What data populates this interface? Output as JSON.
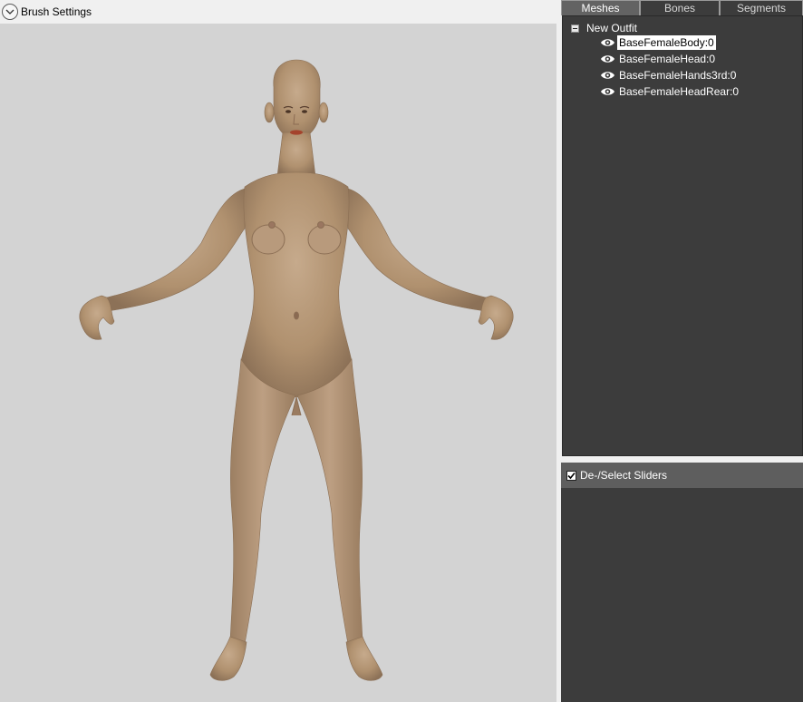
{
  "brush_settings": {
    "label": "Brush Settings",
    "icon": "chevron-down-icon",
    "expanded": false
  },
  "tabs": [
    {
      "label": "Meshes",
      "active": true
    },
    {
      "label": "Bones",
      "active": false
    },
    {
      "label": "Segments",
      "active": false
    }
  ],
  "mesh_tree": {
    "root": {
      "label": "New Outfit",
      "expanded": true
    },
    "items": [
      {
        "label": "BaseFemaleBody:0",
        "icon": "eye-icon",
        "visible": true,
        "selected": true
      },
      {
        "label": "BaseFemaleHead:0",
        "icon": "eye-icon",
        "visible": true,
        "selected": false
      },
      {
        "label": "BaseFemaleHands3rd:0",
        "icon": "eye-icon",
        "visible": true,
        "selected": false
      },
      {
        "label": "BaseFemaleHeadRear:0",
        "icon": "eye-icon",
        "visible": true,
        "selected": false
      }
    ]
  },
  "sliders": {
    "toggle_label": "De-/Select Sliders",
    "checked": true
  },
  "colors": {
    "viewport_bg": "#d3d3d3",
    "panel_bg": "#3c3c3c",
    "header_bg": "#5e5e5e",
    "active_tab": "#636363",
    "skin": "#b4977a"
  }
}
